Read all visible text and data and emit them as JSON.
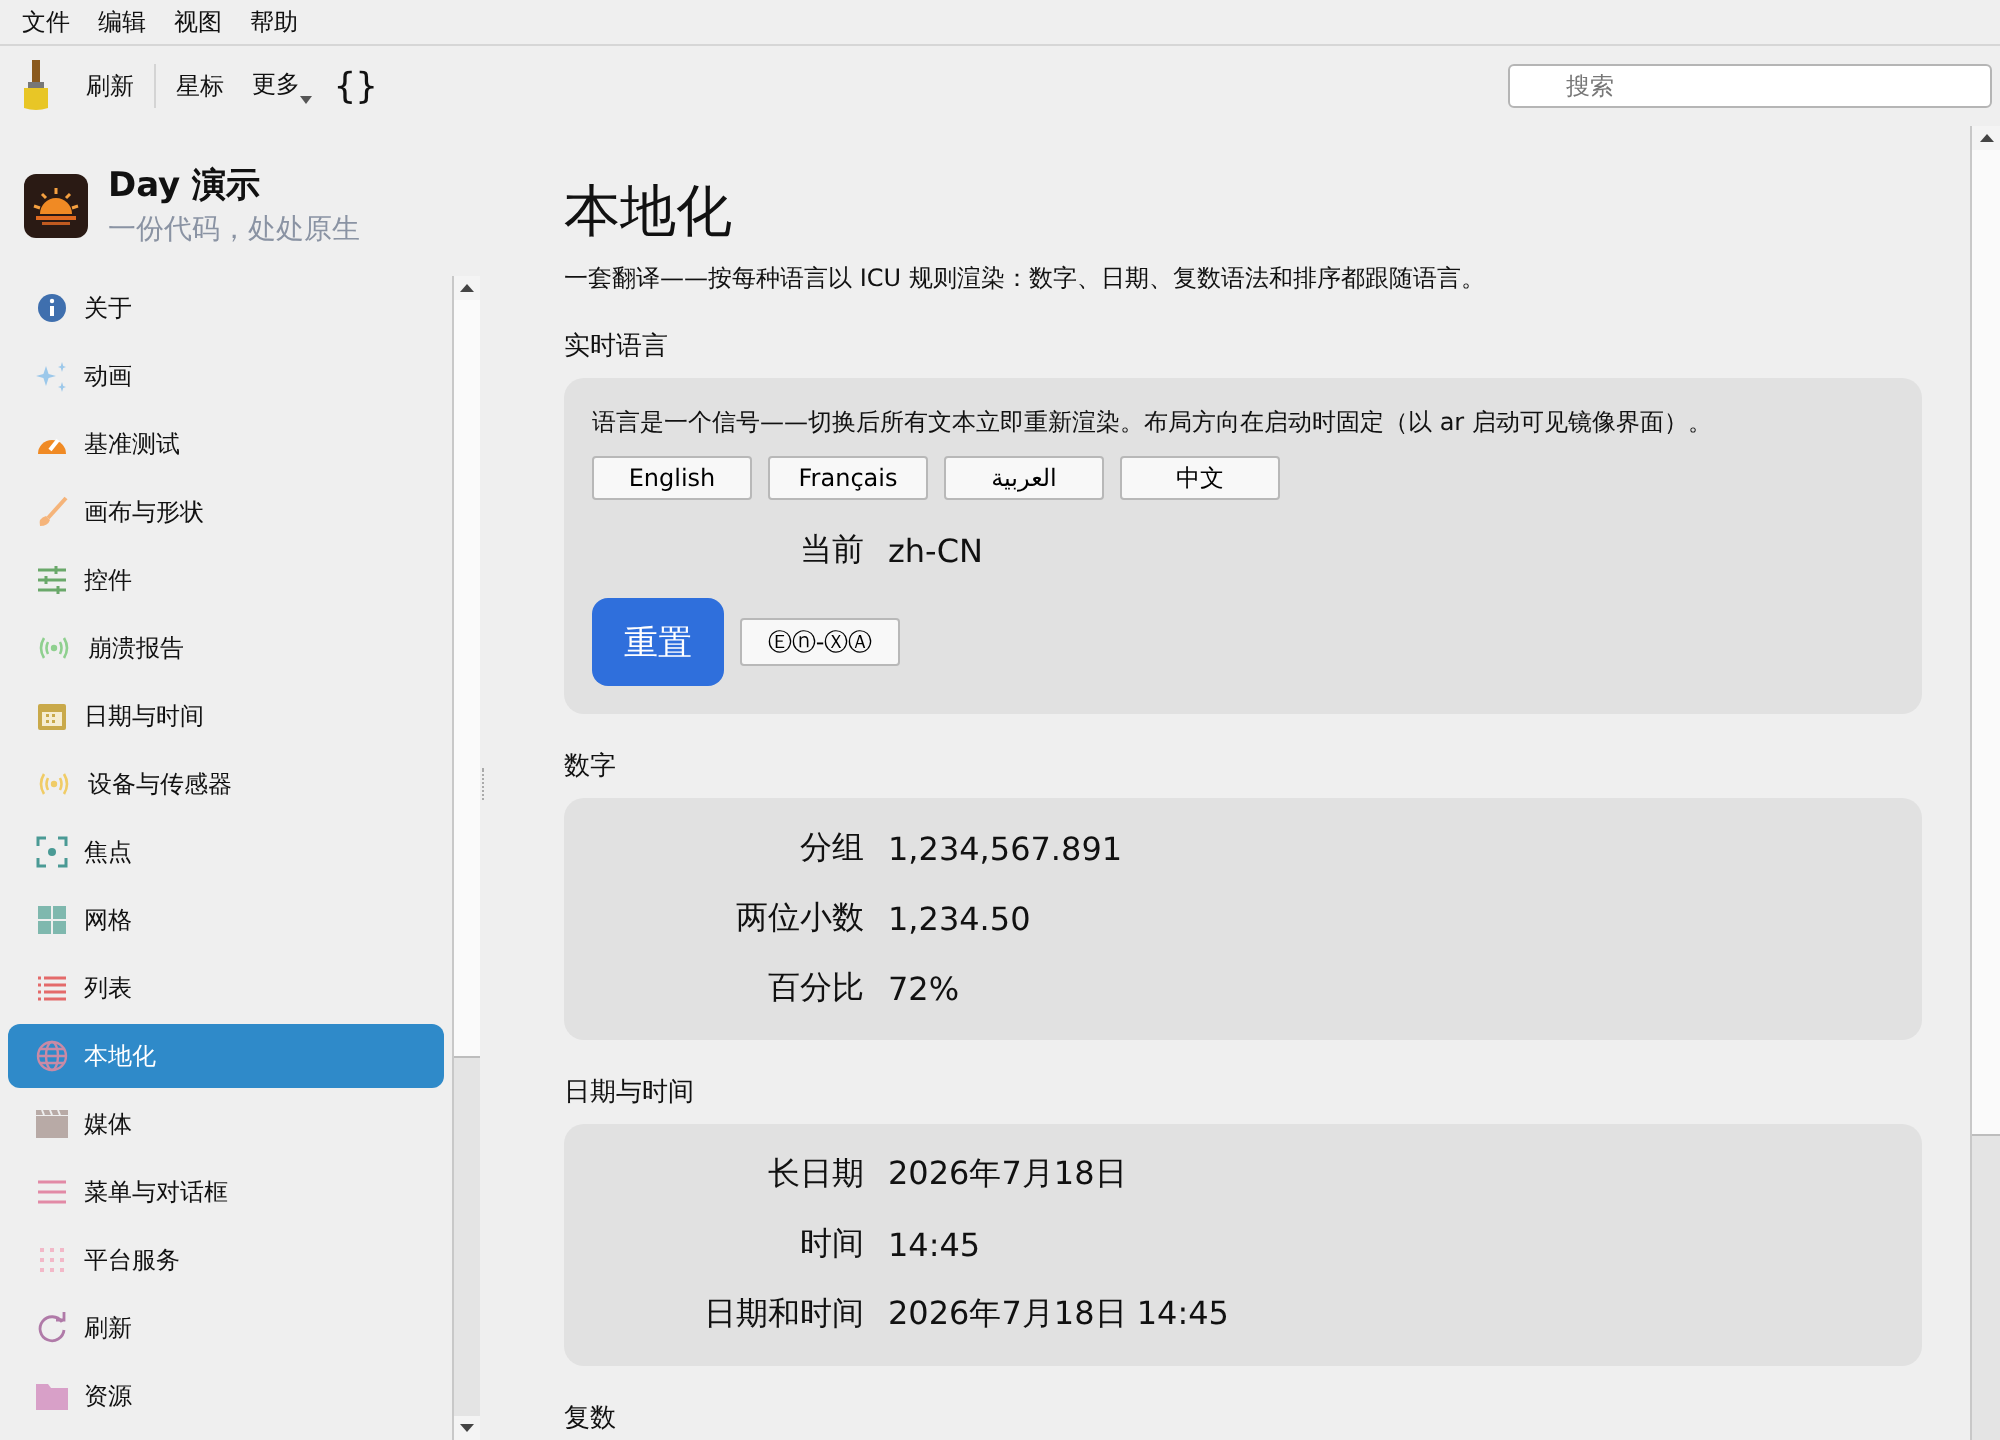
{
  "menu_bar": [
    "文件",
    "编辑",
    "视图",
    "帮助"
  ],
  "toolbar": {
    "buttons": [
      "刷新",
      "星标",
      "更多"
    ],
    "braces": "{}",
    "search": {
      "placeholder": "搜索"
    }
  },
  "app": {
    "name": "Day 演示",
    "tagline": "一份代码，处处原生"
  },
  "sidebar": {
    "items": [
      {
        "label": "关于",
        "selected": false,
        "color": "#3f6fae"
      },
      {
        "label": "动画",
        "selected": false,
        "color": "#9cc8ea"
      },
      {
        "label": "基准测试",
        "selected": false,
        "color": "#f08a24"
      },
      {
        "label": "画布与形状",
        "selected": false,
        "color": "#f5b47a"
      },
      {
        "label": "控件",
        "selected": false,
        "color": "#6aa86a"
      },
      {
        "label": "崩溃报告",
        "selected": false,
        "color": "#8fd08f"
      },
      {
        "label": "日期与时间",
        "selected": false,
        "color": "#c9a94a"
      },
      {
        "label": "设备与传感器",
        "selected": false,
        "color": "#f0cc66"
      },
      {
        "label": "焦点",
        "selected": false,
        "color": "#4a9a95"
      },
      {
        "label": "网格",
        "selected": false,
        "color": "#7fb8ae"
      },
      {
        "label": "列表",
        "selected": false,
        "color": "#e46a6a"
      },
      {
        "label": "本地化",
        "selected": true,
        "color": "#c98aa6"
      },
      {
        "label": "媒体",
        "selected": false,
        "color": "#b8aaa6"
      },
      {
        "label": "菜单与对话框",
        "selected": false,
        "color": "#e28aa6"
      },
      {
        "label": "平台服务",
        "selected": false,
        "color": "#f2b8c8"
      },
      {
        "label": "刷新",
        "selected": false,
        "color": "#b07aa8"
      },
      {
        "label": "资源",
        "selected": false,
        "color": "#d8a0c8"
      }
    ]
  },
  "page": {
    "title": "本地化",
    "subtitle": "一套翻译——按每种语言以 ICU 规则渲染：数字、日期、复数语法和排序都跟随语言。",
    "live_language": {
      "heading": "实时语言",
      "description": "语言是一个信号——切换后所有文本立即重新渲染。布局方向在启动时固定（以 ar 启动可见镜像界面）。",
      "languages": [
        "English",
        "Français",
        "العربية",
        "中文"
      ],
      "current": {
        "label": "当前",
        "value": "zh-CN"
      },
      "reset_button": "重置",
      "pseudo_button": "Ⓔⓝ-ⓍⒶ"
    },
    "sections": [
      {
        "heading": "数字",
        "rows": [
          {
            "label": "分组",
            "value": "1,234,567.891"
          },
          {
            "label": "两位小数",
            "value": "1,234.50"
          },
          {
            "label": "百分比",
            "value": "72%"
          }
        ]
      },
      {
        "heading": "日期与时间",
        "rows": [
          {
            "label": "长日期",
            "value": "2026年7月18日"
          },
          {
            "label": "时间",
            "value": "14:45"
          },
          {
            "label": "日期和时间",
            "value": "2026年7月18日 14:45"
          }
        ]
      },
      {
        "heading": "复数"
      }
    ]
  }
}
